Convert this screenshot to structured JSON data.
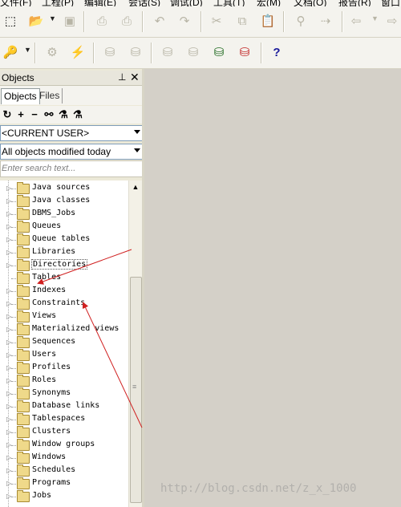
{
  "menubar": {
    "items": [
      "文件(F)",
      "工程(P)",
      "编辑(E)",
      "会话(S)",
      "调试(D)",
      "工具(T)",
      "宏(M)",
      "文档(O)",
      "报告(R)",
      "窗口"
    ]
  },
  "objects_panel": {
    "title": "Objects",
    "pin_glyph": "⊥",
    "close_glyph": "✕",
    "tabs": [
      "Objects",
      "Files"
    ],
    "user_select": "<CURRENT USER>",
    "filter_select": "All objects modified today",
    "search_placeholder": "Enter search text...",
    "tree": [
      "Java sources",
      "Java classes",
      "DBMS_Jobs",
      "Queues",
      "Queue tables",
      "Libraries",
      "Directories",
      "Tables",
      "Indexes",
      "Constraints",
      "Views",
      "Materialized views",
      "Sequences",
      "Users",
      "Profiles",
      "Roles",
      "Synonyms",
      "Database links",
      "Tablespaces",
      "Clusters",
      "Window groups",
      "Windows",
      "Schedules",
      "Programs",
      "Jobs"
    ]
  },
  "watermark": "http://blog.csdn.net/z_x_1000",
  "icons": {
    "toolbar1": [
      "new-icon",
      "open-icon",
      "save-icon",
      "print-icon",
      "print-preview-icon",
      "undo-icon",
      "redo-icon",
      "cut-icon",
      "copy-icon",
      "paste-icon",
      "find-icon",
      "replace-icon",
      "back-icon",
      "forward-icon"
    ],
    "toolbar2": [
      "key-icon",
      "settings-icon",
      "wand-icon",
      "db-down-icon",
      "db-up-icon",
      "db-query-icon",
      "db-psql-icon",
      "db-run-icon",
      "db-refresh-icon",
      "help-icon"
    ]
  },
  "colors": {
    "annotation_arrow": "#d02020",
    "folder": "#efd98a",
    "main_bg": "#d4d0c8"
  }
}
